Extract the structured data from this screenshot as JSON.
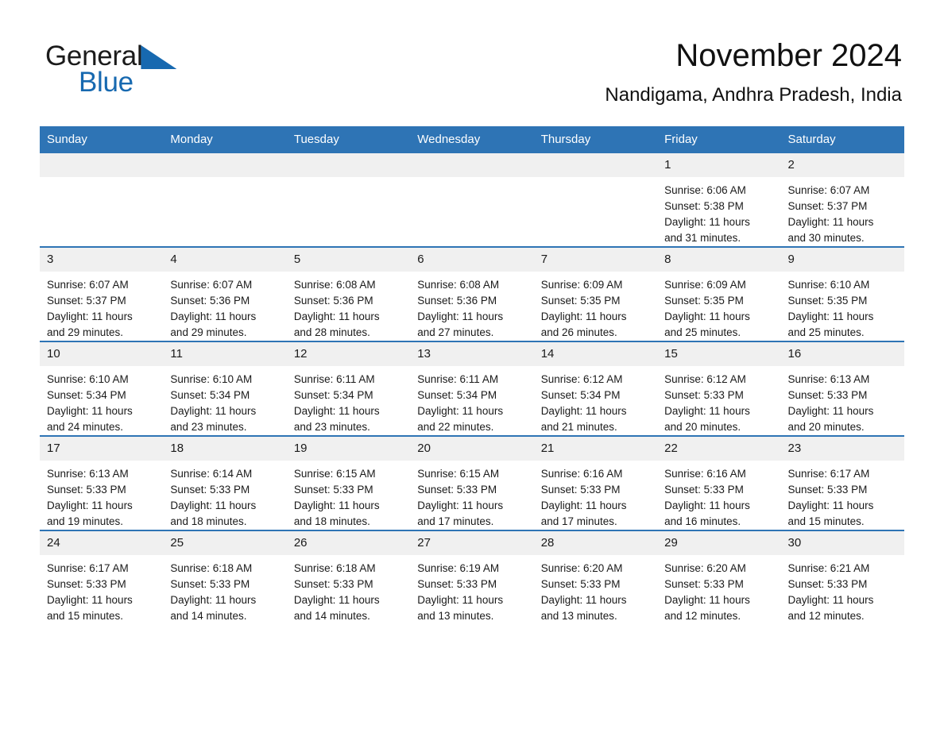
{
  "brand": {
    "name_part1": "General",
    "name_part2": "Blue",
    "accent_color": "#1769b0"
  },
  "header": {
    "title": "November 2024",
    "subtitle": "Nandigama, Andhra Pradesh, India"
  },
  "theme": {
    "header_blue": "#2e74b5",
    "daynum_gray": "#f0f0f0",
    "separator_blue": "#2e74b5"
  },
  "weekdays": [
    "Sunday",
    "Monday",
    "Tuesday",
    "Wednesday",
    "Thursday",
    "Friday",
    "Saturday"
  ],
  "weeks": [
    [
      {
        "day": "",
        "sunrise": "",
        "sunset": "",
        "daylight_line1": "",
        "daylight_line2": "",
        "empty": true
      },
      {
        "day": "",
        "sunrise": "",
        "sunset": "",
        "daylight_line1": "",
        "daylight_line2": "",
        "empty": true
      },
      {
        "day": "",
        "sunrise": "",
        "sunset": "",
        "daylight_line1": "",
        "daylight_line2": "",
        "empty": true
      },
      {
        "day": "",
        "sunrise": "",
        "sunset": "",
        "daylight_line1": "",
        "daylight_line2": "",
        "empty": true
      },
      {
        "day": "",
        "sunrise": "",
        "sunset": "",
        "daylight_line1": "",
        "daylight_line2": "",
        "empty": true
      },
      {
        "day": "1",
        "sunrise": "Sunrise: 6:06 AM",
        "sunset": "Sunset: 5:38 PM",
        "daylight_line1": "Daylight: 11 hours",
        "daylight_line2": "and 31 minutes.",
        "empty": false
      },
      {
        "day": "2",
        "sunrise": "Sunrise: 6:07 AM",
        "sunset": "Sunset: 5:37 PM",
        "daylight_line1": "Daylight: 11 hours",
        "daylight_line2": "and 30 minutes.",
        "empty": false
      }
    ],
    [
      {
        "day": "3",
        "sunrise": "Sunrise: 6:07 AM",
        "sunset": "Sunset: 5:37 PM",
        "daylight_line1": "Daylight: 11 hours",
        "daylight_line2": "and 29 minutes.",
        "empty": false
      },
      {
        "day": "4",
        "sunrise": "Sunrise: 6:07 AM",
        "sunset": "Sunset: 5:36 PM",
        "daylight_line1": "Daylight: 11 hours",
        "daylight_line2": "and 29 minutes.",
        "empty": false
      },
      {
        "day": "5",
        "sunrise": "Sunrise: 6:08 AM",
        "sunset": "Sunset: 5:36 PM",
        "daylight_line1": "Daylight: 11 hours",
        "daylight_line2": "and 28 minutes.",
        "empty": false
      },
      {
        "day": "6",
        "sunrise": "Sunrise: 6:08 AM",
        "sunset": "Sunset: 5:36 PM",
        "daylight_line1": "Daylight: 11 hours",
        "daylight_line2": "and 27 minutes.",
        "empty": false
      },
      {
        "day": "7",
        "sunrise": "Sunrise: 6:09 AM",
        "sunset": "Sunset: 5:35 PM",
        "daylight_line1": "Daylight: 11 hours",
        "daylight_line2": "and 26 minutes.",
        "empty": false
      },
      {
        "day": "8",
        "sunrise": "Sunrise: 6:09 AM",
        "sunset": "Sunset: 5:35 PM",
        "daylight_line1": "Daylight: 11 hours",
        "daylight_line2": "and 25 minutes.",
        "empty": false
      },
      {
        "day": "9",
        "sunrise": "Sunrise: 6:10 AM",
        "sunset": "Sunset: 5:35 PM",
        "daylight_line1": "Daylight: 11 hours",
        "daylight_line2": "and 25 minutes.",
        "empty": false
      }
    ],
    [
      {
        "day": "10",
        "sunrise": "Sunrise: 6:10 AM",
        "sunset": "Sunset: 5:34 PM",
        "daylight_line1": "Daylight: 11 hours",
        "daylight_line2": "and 24 minutes.",
        "empty": false
      },
      {
        "day": "11",
        "sunrise": "Sunrise: 6:10 AM",
        "sunset": "Sunset: 5:34 PM",
        "daylight_line1": "Daylight: 11 hours",
        "daylight_line2": "and 23 minutes.",
        "empty": false
      },
      {
        "day": "12",
        "sunrise": "Sunrise: 6:11 AM",
        "sunset": "Sunset: 5:34 PM",
        "daylight_line1": "Daylight: 11 hours",
        "daylight_line2": "and 23 minutes.",
        "empty": false
      },
      {
        "day": "13",
        "sunrise": "Sunrise: 6:11 AM",
        "sunset": "Sunset: 5:34 PM",
        "daylight_line1": "Daylight: 11 hours",
        "daylight_line2": "and 22 minutes.",
        "empty": false
      },
      {
        "day": "14",
        "sunrise": "Sunrise: 6:12 AM",
        "sunset": "Sunset: 5:34 PM",
        "daylight_line1": "Daylight: 11 hours",
        "daylight_line2": "and 21 minutes.",
        "empty": false
      },
      {
        "day": "15",
        "sunrise": "Sunrise: 6:12 AM",
        "sunset": "Sunset: 5:33 PM",
        "daylight_line1": "Daylight: 11 hours",
        "daylight_line2": "and 20 minutes.",
        "empty": false
      },
      {
        "day": "16",
        "sunrise": "Sunrise: 6:13 AM",
        "sunset": "Sunset: 5:33 PM",
        "daylight_line1": "Daylight: 11 hours",
        "daylight_line2": "and 20 minutes.",
        "empty": false
      }
    ],
    [
      {
        "day": "17",
        "sunrise": "Sunrise: 6:13 AM",
        "sunset": "Sunset: 5:33 PM",
        "daylight_line1": "Daylight: 11 hours",
        "daylight_line2": "and 19 minutes.",
        "empty": false
      },
      {
        "day": "18",
        "sunrise": "Sunrise: 6:14 AM",
        "sunset": "Sunset: 5:33 PM",
        "daylight_line1": "Daylight: 11 hours",
        "daylight_line2": "and 18 minutes.",
        "empty": false
      },
      {
        "day": "19",
        "sunrise": "Sunrise: 6:15 AM",
        "sunset": "Sunset: 5:33 PM",
        "daylight_line1": "Daylight: 11 hours",
        "daylight_line2": "and 18 minutes.",
        "empty": false
      },
      {
        "day": "20",
        "sunrise": "Sunrise: 6:15 AM",
        "sunset": "Sunset: 5:33 PM",
        "daylight_line1": "Daylight: 11 hours",
        "daylight_line2": "and 17 minutes.",
        "empty": false
      },
      {
        "day": "21",
        "sunrise": "Sunrise: 6:16 AM",
        "sunset": "Sunset: 5:33 PM",
        "daylight_line1": "Daylight: 11 hours",
        "daylight_line2": "and 17 minutes.",
        "empty": false
      },
      {
        "day": "22",
        "sunrise": "Sunrise: 6:16 AM",
        "sunset": "Sunset: 5:33 PM",
        "daylight_line1": "Daylight: 11 hours",
        "daylight_line2": "and 16 minutes.",
        "empty": false
      },
      {
        "day": "23",
        "sunrise": "Sunrise: 6:17 AM",
        "sunset": "Sunset: 5:33 PM",
        "daylight_line1": "Daylight: 11 hours",
        "daylight_line2": "and 15 minutes.",
        "empty": false
      }
    ],
    [
      {
        "day": "24",
        "sunrise": "Sunrise: 6:17 AM",
        "sunset": "Sunset: 5:33 PM",
        "daylight_line1": "Daylight: 11 hours",
        "daylight_line2": "and 15 minutes.",
        "empty": false
      },
      {
        "day": "25",
        "sunrise": "Sunrise: 6:18 AM",
        "sunset": "Sunset: 5:33 PM",
        "daylight_line1": "Daylight: 11 hours",
        "daylight_line2": "and 14 minutes.",
        "empty": false
      },
      {
        "day": "26",
        "sunrise": "Sunrise: 6:18 AM",
        "sunset": "Sunset: 5:33 PM",
        "daylight_line1": "Daylight: 11 hours",
        "daylight_line2": "and 14 minutes.",
        "empty": false
      },
      {
        "day": "27",
        "sunrise": "Sunrise: 6:19 AM",
        "sunset": "Sunset: 5:33 PM",
        "daylight_line1": "Daylight: 11 hours",
        "daylight_line2": "and 13 minutes.",
        "empty": false
      },
      {
        "day": "28",
        "sunrise": "Sunrise: 6:20 AM",
        "sunset": "Sunset: 5:33 PM",
        "daylight_line1": "Daylight: 11 hours",
        "daylight_line2": "and 13 minutes.",
        "empty": false
      },
      {
        "day": "29",
        "sunrise": "Sunrise: 6:20 AM",
        "sunset": "Sunset: 5:33 PM",
        "daylight_line1": "Daylight: 11 hours",
        "daylight_line2": "and 12 minutes.",
        "empty": false
      },
      {
        "day": "30",
        "sunrise": "Sunrise: 6:21 AM",
        "sunset": "Sunset: 5:33 PM",
        "daylight_line1": "Daylight: 11 hours",
        "daylight_line2": "and 12 minutes.",
        "empty": false
      }
    ]
  ]
}
